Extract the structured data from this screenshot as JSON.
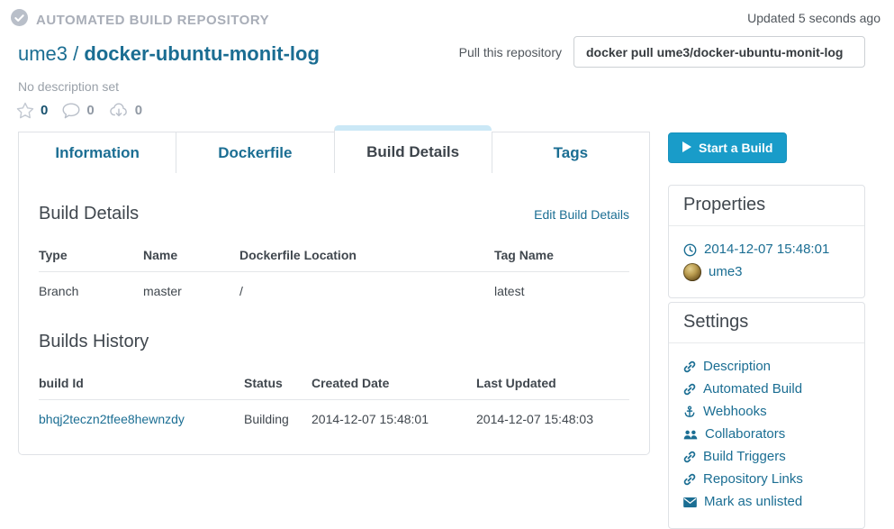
{
  "header": {
    "badge": "AUTOMATED BUILD REPOSITORY",
    "namespace": "ume3 /",
    "repo_name": "docker-ubuntu-monit-log",
    "description": "No description set",
    "stats": {
      "stars": "0",
      "comments": "0",
      "pulls": "0"
    },
    "updated": "Updated 5 seconds ago",
    "pull_label": "Pull this repository",
    "pull_command": "docker pull ume3/docker-ubuntu-monit-log"
  },
  "tabs": [
    {
      "label": "Information",
      "active": false
    },
    {
      "label": "Dockerfile",
      "active": false
    },
    {
      "label": "Build Details",
      "active": true
    },
    {
      "label": "Tags",
      "active": false
    }
  ],
  "build_details": {
    "title": "Build Details",
    "edit_link": "Edit Build Details",
    "columns": [
      "Type",
      "Name",
      "Dockerfile Location",
      "Tag Name"
    ],
    "rows": [
      [
        "Branch",
        "master",
        "/",
        "latest"
      ]
    ]
  },
  "builds_history": {
    "title": "Builds History",
    "columns": [
      "build Id",
      "Status",
      "Created Date",
      "Last Updated"
    ],
    "rows": [
      [
        "bhqj2teczn2tfee8hewnzdy",
        "Building",
        "2014-12-07 15:48:01",
        "2014-12-07 15:48:03"
      ]
    ]
  },
  "sidebar": {
    "start_build_label": "Start a Build",
    "properties": {
      "title": "Properties",
      "created": "2014-12-07 15:48:01",
      "owner": "ume3"
    },
    "settings": {
      "title": "Settings",
      "items": [
        {
          "icon": "link-icon",
          "label": "Description"
        },
        {
          "icon": "link-icon",
          "label": "Automated Build"
        },
        {
          "icon": "anchor-icon",
          "label": "Webhooks"
        },
        {
          "icon": "users-icon",
          "label": "Collaborators"
        },
        {
          "icon": "link-icon",
          "label": "Build Triggers"
        },
        {
          "icon": "link-icon",
          "label": "Repository Links"
        },
        {
          "icon": "envelope-icon",
          "label": "Mark as unlisted"
        }
      ]
    }
  },
  "colors": {
    "link": "#1b6e93",
    "button": "#199cc9",
    "active_tab_stripe": "#cbe8f6",
    "muted_gray": "#a9aeb8"
  }
}
